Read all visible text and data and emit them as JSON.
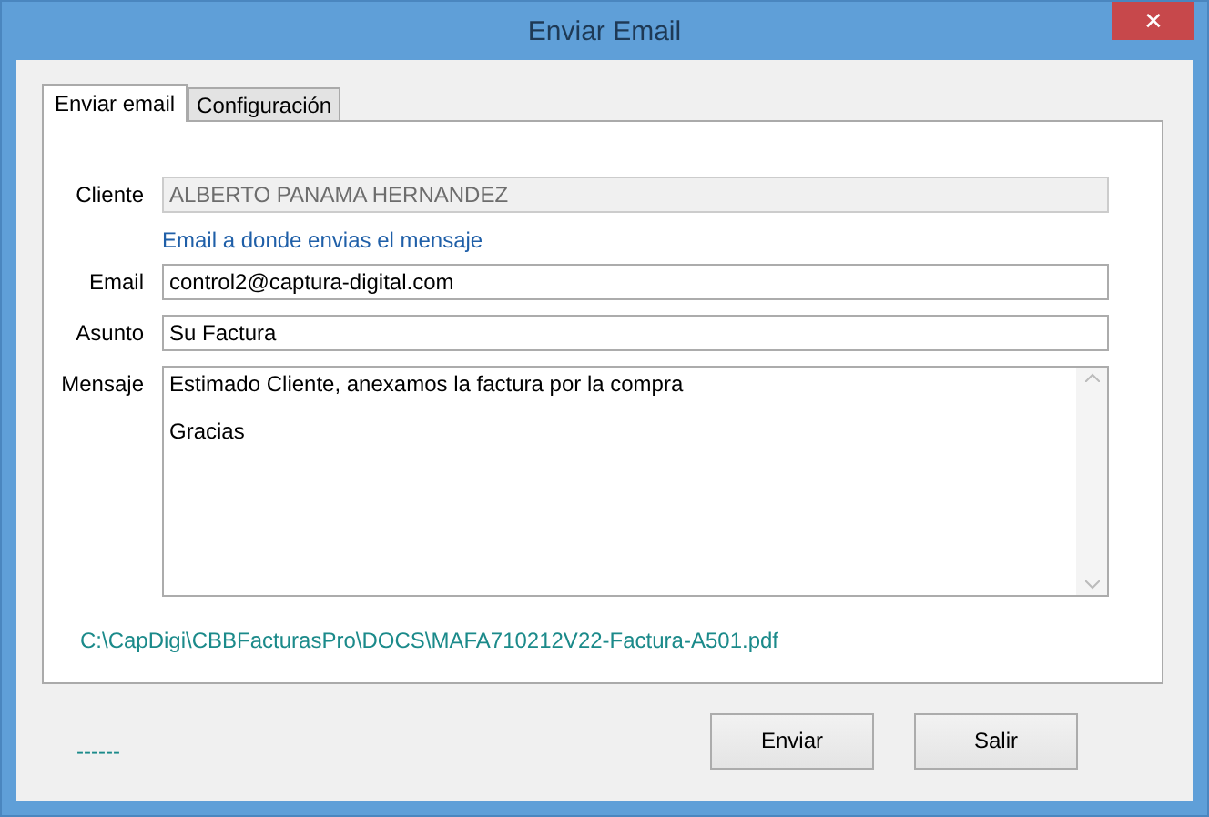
{
  "window": {
    "title": "Enviar Email",
    "close": "✕"
  },
  "tabs": [
    {
      "label": "Enviar email",
      "selected": true
    },
    {
      "label": "Configuración",
      "selected": false
    }
  ],
  "form": {
    "cliente": {
      "label": "Cliente",
      "value": "ALBERTO PANAMA HERNANDEZ",
      "disabled": true
    },
    "hint": "Email a donde envias el mensaje",
    "email": {
      "label": "Email",
      "value": "control2@captura-digital.com"
    },
    "asunto": {
      "label": "Asunto",
      "value": "Su Factura"
    },
    "mensaje": {
      "label": "Mensaje",
      "paragraphs": [
        "Estimado Cliente, anexamos la factura por la compra",
        "Gracias"
      ]
    },
    "attachment": "C:\\CapDigi\\CBBFacturasPro\\DOCS\\MAFA710212V22-Factura-A501.pdf"
  },
  "status": "------",
  "buttons": [
    "Enviar",
    "Salir"
  ]
}
